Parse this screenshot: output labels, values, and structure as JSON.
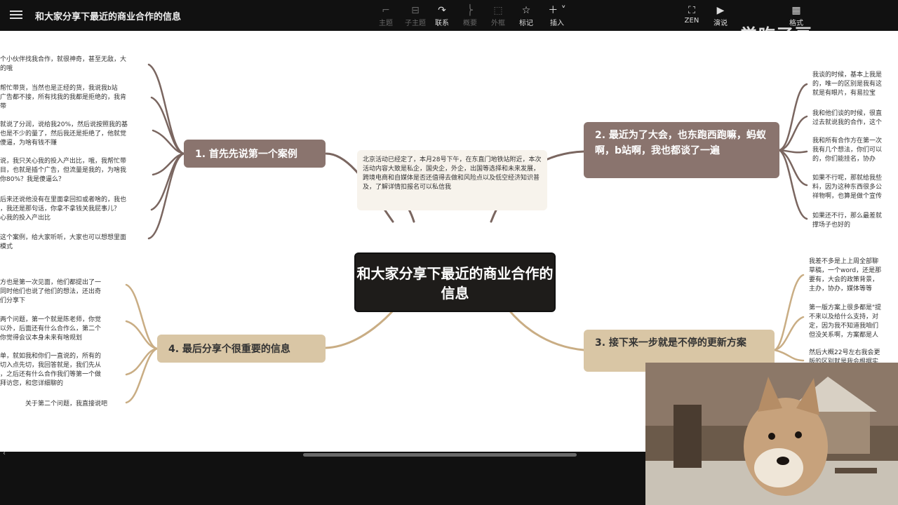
{
  "app": {
    "title": "和大家分享下最近的商业合作的信息",
    "watermark": "觉吃了豆"
  },
  "toolbar": {
    "center_tools": [
      {
        "label": "主题",
        "icon": "topic-icon",
        "dim": true
      },
      {
        "label": "子主题",
        "icon": "subtopic-icon",
        "dim": true
      },
      {
        "label": "联系",
        "icon": "relation-icon",
        "dim": false
      },
      {
        "label": "概要",
        "icon": "summary-icon",
        "dim": true
      },
      {
        "label": "外框",
        "icon": "boundary-icon",
        "dim": true
      },
      {
        "label": "标记",
        "icon": "star-icon",
        "dim": false
      },
      {
        "label": "插入",
        "icon": "plus-icon",
        "dim": false
      }
    ],
    "right_tools": [
      {
        "label": "ZEN",
        "icon": "zen-icon"
      },
      {
        "label": "演说",
        "icon": "present-icon"
      },
      {
        "label": "格式",
        "icon": "format-icon"
      }
    ]
  },
  "mindmap": {
    "center": "和大家分享下最近的商业合作的信息",
    "note": "北京活动已经定了，本月28号下午，在东直门地铁站附近，本次活动内容大致是私企，国央企，外企，出国等选择和未来发展，跨境电商和自媒体是否还值得去做和风险点以及低空经济知识普及，了解详情扣报名可以私信我",
    "branches": [
      {
        "label": "1. 首先先说第一个案例",
        "leaves": [
          "个小伙伴找我合作，就很神奇，甚至无敌，大\n的哦",
          "帮忙带货，当然也是正经的货，我说我b站\n广告都不接，所有找我的我都是拒绝的，我肯\n带",
          "就说了分润，说给我20%，然后说按照我的基\n也是不少的量了，然后我还是拒绝了，他就觉\n傻逼，为啥有钱不赚",
          "说，我只关心我的投入产出比，哦，我帮忙带\n目，也就是插个广告，但流量是我的，为啥我\n你80%？我是傻逼么？",
          "后来还说他没有在里面拿回扣或者啥的，我也\n，我还是那句话，你拿不拿钱关我屁事儿？\n心我的投入产出比",
          "这个案例，给大家听听，大家也可以想想里面\n模式"
        ]
      },
      {
        "label": "2. 最近为了大会，也东跑西跑嘛，蚂蚁啊，b站啊，我也都谈了一遍",
        "leaves": [
          "我谈的时候，基本上我是\n的，唯一的区别是我有这\n就是有眼片，有易拉宝",
          "我和他们谈的时候，很直\n过去就说我的合作，这个",
          "我和所有合作方在第一次\n我有几个想法，你们可以\n的，你们能挂名，协办",
          "如果不行呢，那就给我些\n料，因为这种东西很多公\n祥物啊，也算是做个宣传",
          "如果还不行，那么最差就\n撑场子也好的"
        ]
      },
      {
        "label": "3. 接下来一步就是不停的更新方案",
        "leaves": [
          "我差不多是上上周全部聊\n草稿，一个word，还是那\n要有，大会的政策背景，\n主办，协办，媒体等等",
          "第一版方案上很多都是\"提\n不来以及给什么支持，对\n定，因为我不知道我咱们\n但没关系啊，方案都是人",
          "然后大概22号左右我会更\n版的区别就是我会根据实"
        ]
      },
      {
        "label": "4. 最后分享个很重要的信息",
        "leaves": [
          "方也是第一次见面，他们都提出了一\n同时他们也说了他们的想法，还出奇\n们分享下",
          "两个问题，第一个就是陈老师，你觉\n以外，后面还有什么合作么，第二个\n你觉得会议本身未来有啥规划",
          "单，就如我和你们一直说的，所有的\n切入点先切，我回答就是，我们先从\n，之后还有什么合作我们等第一个做\n拜访您，和您详细聊的",
          "关于第二个问题，我直接说吧"
        ]
      }
    ]
  },
  "colors": {
    "dark_branch": "#8a746e",
    "light_branch": "#d9c6a5",
    "center": "#1e1c1a",
    "dark_link": "#7a6660",
    "light_link": "#c9ad84"
  }
}
